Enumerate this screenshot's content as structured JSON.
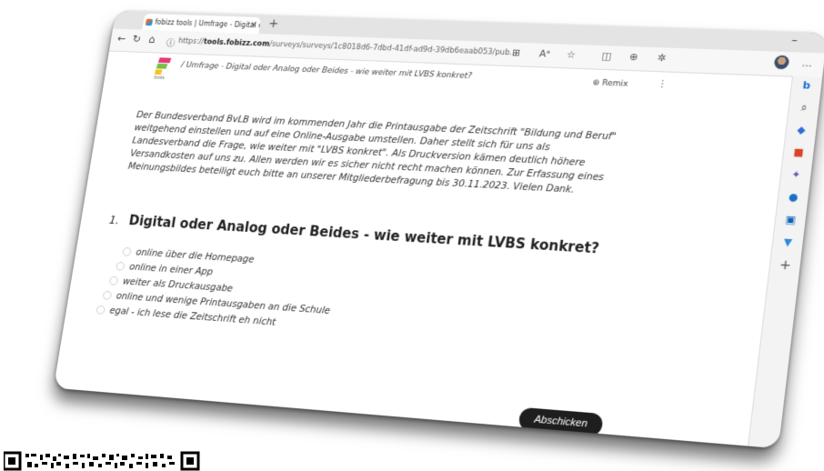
{
  "browser": {
    "tab_title": "fobizz tools | Umfrage - Digital o",
    "tab_close": "×",
    "new_tab": "+",
    "minimize": "–",
    "url_prefix": "https://",
    "url_host": "tools.fobizz.com",
    "url_path": "/surveys/surveys/1c8018d6-7dbd-41df-ad9d-39db6eaab053/pub...",
    "more": "..."
  },
  "header": {
    "logo_text": "tools",
    "breadcrumb": "/ Umfrage - Digital oder Analog oder Beides - wie weiter mit LVBS konkret?",
    "remix_label": "Remix",
    "menu": "⋮"
  },
  "intro_text": "Der Bundesverband BvLB wird im kommenden Jahr die Printausgabe der Zeitschrift \"Bildung und Beruf\" weitgehend einstellen und auf eine Online-Ausgabe umstellen. Daher stellt sich für uns als Landesverband die Frage, wie weiter mit \"LVBS konkret\". Als Druckversion kämen deutlich höhere Versandkosten auf uns zu. Allen werden wir es sicher nicht recht machen können. Zur Erfassung eines Meinungsbildes beteiligt euch bitte an unserer Mitgliederbefragung bis 30.11.2023. Vielen Dank.",
  "question": {
    "number": "1.",
    "title": "Digital oder Analog oder Beides - wie weiter mit LVBS konkret?",
    "options": [
      "online über die Homepage",
      "online in einer App",
      "weiter als Druckausgabe",
      "online und wenige Printausgaben an die Schule",
      "egal - ich lese die Zeitschrift eh nicht"
    ]
  },
  "submit_label": "Abschicken",
  "colors": {
    "button_bg": "#1e1e1e",
    "logo_pink": "#e6397a",
    "logo_green": "#7ac143",
    "logo_yellow": "#f6c21c"
  }
}
